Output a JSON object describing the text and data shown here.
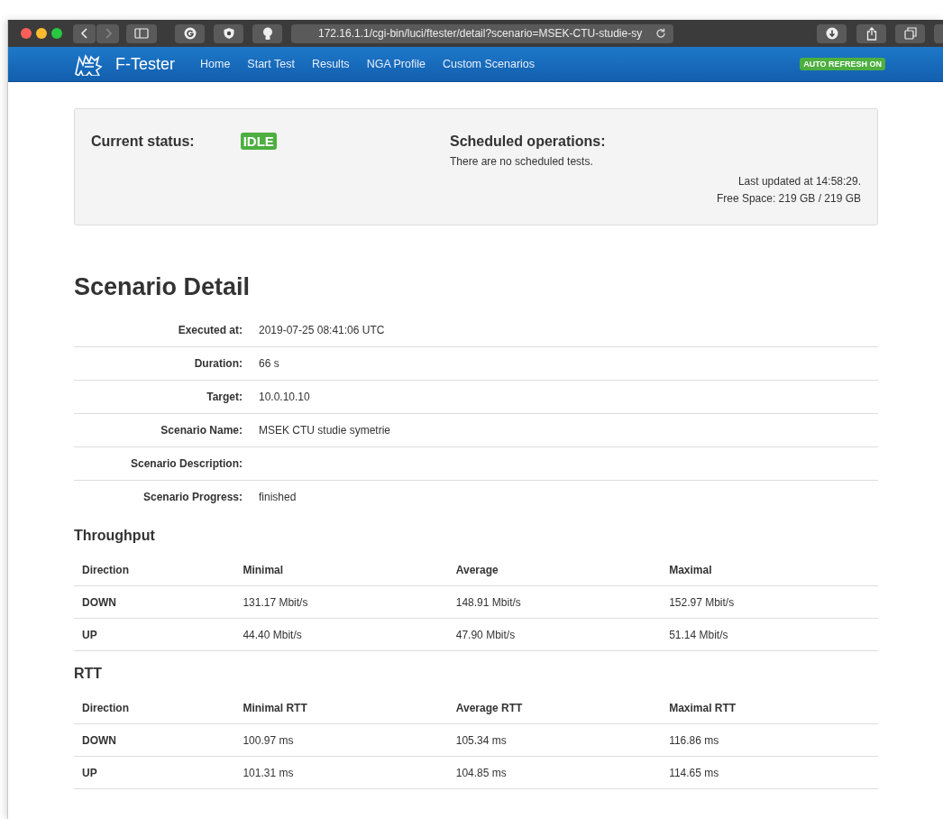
{
  "browser": {
    "address": "172.16.1.1/cgi-bin/luci/ftester/detail?scenario=MSEK-CTU-studie-sy"
  },
  "navbar": {
    "brand": "F-Tester",
    "items": [
      "Home",
      "Start Test",
      "Results",
      "NGA Profile",
      "Custom Scenarios"
    ],
    "badge": {
      "label": "AUTO REFRESH ON",
      "color": "#4caf3f"
    }
  },
  "status_panel": {
    "status_label": "Current status:",
    "status": {
      "label": "IDLE",
      "color": "#4caf3f"
    },
    "scheduled_title": "Scheduled operations:",
    "scheduled_text": "There are no scheduled tests.",
    "last_updated": "Last updated at 14:58:29.",
    "free_space": "Free Space: 219 GB / 219 GB"
  },
  "title": "Scenario Detail",
  "details": [
    {
      "label": "Executed at:",
      "value": "2019-07-25 08:41:06 UTC"
    },
    {
      "label": "Duration:",
      "value": "66 s"
    },
    {
      "label": "Target:",
      "value": "10.0.10.10"
    },
    {
      "label": "Scenario Name:",
      "value": "MSEK CTU studie symetrie"
    },
    {
      "label": "Scenario Description:"
    },
    {
      "label": "Scenario Progress:",
      "value": "finished"
    }
  ],
  "tables": [
    {
      "title": "Throughput",
      "columns": [
        "Direction",
        "Minimal",
        "Average",
        "Maximal"
      ],
      "rows": [
        [
          "DOWN",
          "131.17 Mbit/s",
          "148.91 Mbit/s",
          "152.97 Mbit/s"
        ],
        [
          "UP",
          "44.40 Mbit/s",
          "47.90 Mbit/s",
          "51.14 Mbit/s"
        ]
      ]
    },
    {
      "title": "RTT",
      "columns": [
        "Direction",
        "Minimal RTT",
        "Average RTT",
        "Maximal RTT"
      ],
      "rows": [
        [
          "DOWN",
          "100.97 ms",
          "105.34 ms",
          "116.86 ms"
        ],
        [
          "UP",
          "101.31 ms",
          "104.85 ms",
          "114.65 ms"
        ]
      ]
    }
  ]
}
